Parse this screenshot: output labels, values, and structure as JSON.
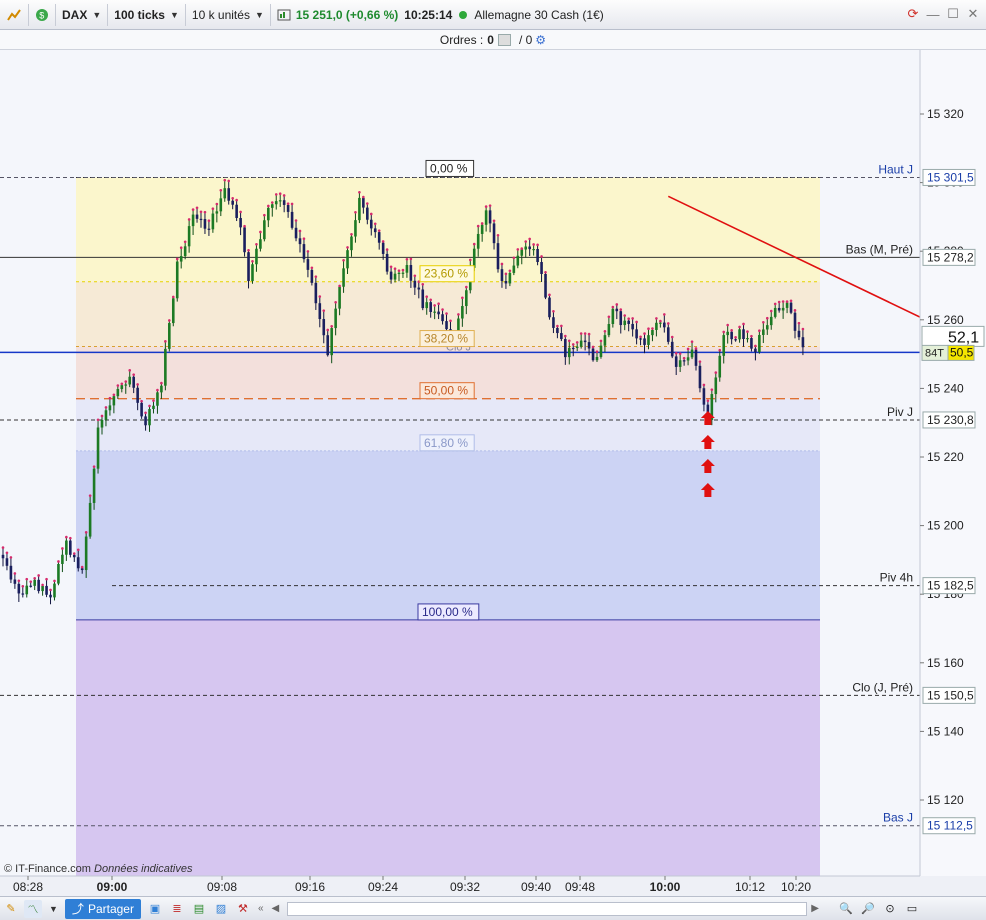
{
  "toolbar": {
    "symbol": "DAX",
    "ticks": "100 ticks",
    "units": "10 k unités",
    "price": "15 251,0 (+0,66 %)",
    "time": "10:25:14",
    "instrument": "Allemagne 30 Cash (1€)"
  },
  "orders": {
    "label": "Ordres :",
    "left": "0",
    "right": "/ 0"
  },
  "watermark": "© IT-Finance.com",
  "watermark_note": "Données indicatives",
  "bottom": {
    "share": "Partager"
  },
  "colors": {
    "up": "#1c7a24",
    "down": "#1a1f5e",
    "wick": "#d62a6c",
    "trend": "#e01010",
    "signal": "#e01010"
  },
  "chart_data": {
    "type": "candlestick",
    "ylim": [
      15100,
      15335
    ],
    "y_ticks": [
      15120,
      15140,
      15160,
      15180,
      15200,
      15220,
      15240,
      15260,
      15280,
      15300,
      15320
    ],
    "y_tick_labels": [
      "15 120",
      "15 140",
      "15 160",
      "15 180",
      "15 200",
      "15 220",
      "15 240",
      "15 260",
      "15 280",
      "15 300",
      "15 320"
    ],
    "x_ticks": [
      "08:28",
      "09:00",
      "09:08",
      "09:16",
      "09:24",
      "09:32",
      "09:40",
      "09:48",
      "10:00",
      "10:12",
      "10:20"
    ],
    "x_tick_bold": [
      "09:00",
      "10:00"
    ],
    "close_path": [
      [
        0,
        15190
      ],
      [
        4,
        15180
      ],
      [
        8,
        15183
      ],
      [
        12,
        15180
      ],
      [
        16,
        15195
      ],
      [
        20,
        15186
      ],
      [
        24,
        15228
      ],
      [
        28,
        15238
      ],
      [
        32,
        15242
      ],
      [
        36,
        15230
      ],
      [
        40,
        15242
      ],
      [
        44,
        15276
      ],
      [
        48,
        15290
      ],
      [
        52,
        15287
      ],
      [
        56,
        15297
      ],
      [
        60,
        15288
      ],
      [
        62,
        15270
      ],
      [
        66,
        15290
      ],
      [
        70,
        15296
      ],
      [
        74,
        15285
      ],
      [
        78,
        15270
      ],
      [
        82,
        15250
      ],
      [
        86,
        15275
      ],
      [
        90,
        15295
      ],
      [
        94,
        15285
      ],
      [
        98,
        15272
      ],
      [
        102,
        15275
      ],
      [
        106,
        15265
      ],
      [
        110,
        15262
      ],
      [
        114,
        15254
      ],
      [
        118,
        15275
      ],
      [
        122,
        15293
      ],
      [
        126,
        15270
      ],
      [
        130,
        15278
      ],
      [
        134,
        15282
      ],
      [
        138,
        15262
      ],
      [
        142,
        15250
      ],
      [
        146,
        15254
      ],
      [
        150,
        15248
      ],
      [
        154,
        15262
      ],
      [
        158,
        15258
      ],
      [
        162,
        15253
      ],
      [
        166,
        15260
      ],
      [
        170,
        15246
      ],
      [
        174,
        15250
      ],
      [
        178,
        15232
      ],
      [
        182,
        15255
      ],
      [
        186,
        15256
      ],
      [
        190,
        15252
      ],
      [
        194,
        15262
      ],
      [
        198,
        15264
      ],
      [
        202,
        15252
      ]
    ],
    "fib_range": {
      "top": 15301.5,
      "bottom": 15172.5
    },
    "fib_levels": [
      {
        "label": "0,00 %",
        "value": 15301.5,
        "fill": "#fbf6cc",
        "line": "#333333",
        "dash": "4,3"
      },
      {
        "label": "23,60 %",
        "value": 15271.1,
        "fill": "#f6ead6",
        "line": "#e8d000",
        "dash": "3,3"
      },
      {
        "label": "38,20 %",
        "value": 15252.2,
        "fill": "#f3e0dc",
        "line": "#d9a030",
        "dash": "3,3"
      },
      {
        "label": "50,00 %",
        "value": 15237.0,
        "fill": "#e6e8f8",
        "line": "#e07030",
        "dash": "9,5"
      },
      {
        "label": "61,80 %",
        "value": 15221.8,
        "fill": "#ccd3f4",
        "line": "#b0bde8",
        "dash": "2,2"
      },
      {
        "label": "100,00 %",
        "value": 15172.5,
        "fill": "#d6c6f0",
        "line": "#3a3aa0",
        "dash": ""
      }
    ],
    "levels": [
      {
        "label": "Haut J",
        "price": 15301.5,
        "badge": "15 301,5",
        "color": "#1a3ea8",
        "style": "dash"
      },
      {
        "label": "Bas (M, Pré)",
        "price": 15278.2,
        "badge": "15 278,2",
        "color": "#222222",
        "style": "solid"
      },
      {
        "label": "Piv J",
        "price": 15230.8,
        "badge": "15 230,8",
        "color": "#222222",
        "style": "dash"
      },
      {
        "label": "Piv 4h",
        "price": 15182.5,
        "badge": "15 182,5",
        "color": "#222222",
        "style": "dash"
      },
      {
        "label": "Clo (J, Pré)",
        "price": 15150.5,
        "badge": "15 150,5",
        "color": "#222222",
        "style": "dash"
      },
      {
        "label": "Bas J",
        "price": 15112.5,
        "badge": "15 112,5",
        "color": "#1a3ea8",
        "style": "dash"
      }
    ],
    "current_price": {
      "value": 15250.5,
      "badge": "50,5",
      "tag": "84T",
      "big": "52,1"
    },
    "ghost_label": "Clo J",
    "trendline": {
      "from": [
        168,
        15296
      ],
      "to": [
        275,
        15237
      ]
    },
    "signal_arrows": {
      "index": 178,
      "count": 4
    }
  }
}
